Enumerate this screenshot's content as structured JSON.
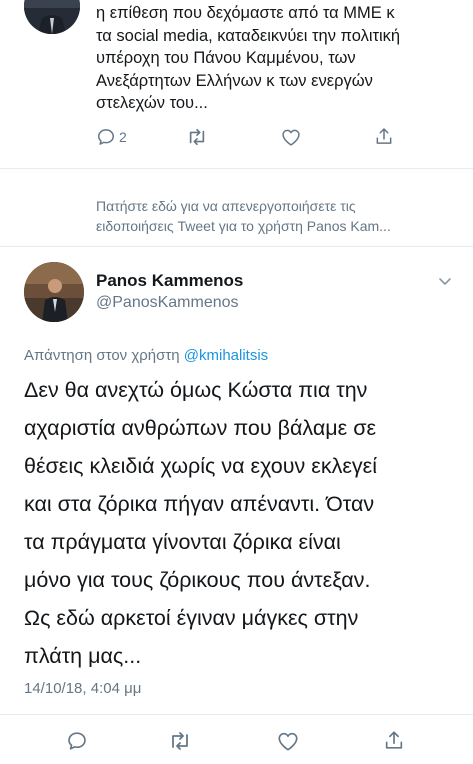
{
  "previous_tweet": {
    "text_lines": [
      "η επίθεση που δεχόμαστε από τα ΜΜΕ κ",
      "τα social media, καταδεικνύει την πολιτική",
      "υπέροχη του Πάνου Καμμένου, των",
      "Ανεξάρτητων Ελλήνων κ των ενεργών",
      "στελεχών του..."
    ],
    "reply_count": "2"
  },
  "notification": {
    "lines": [
      "Πατήστε εδώ για να απενεργοποιήσετε τις",
      "ειδοποιήσεις Tweet για το χρήστη Panos Kam..."
    ]
  },
  "tweet": {
    "display_name": "Panos Kammenos",
    "handle": "@PanosKammenos",
    "reply_prefix": "Απάντηση στον χρήστη ",
    "reply_mention": "@kmihalitsis",
    "text_lines": [
      "Δεν θα ανεχτώ όμως Κώστα πια την",
      "αχαριστία ανθρώπων που βάλαμε σε",
      "θέσεις κλειδιά χωρίς να εχουν εκλεγεί",
      "και στα ζόρικα πήγαν απέναντι. Όταν",
      "τα πράγματα γίνονται ζόρικα είναι",
      "μόνο για τους ζόρικους που άντεξαν.",
      "Ως εδώ αρκετοί έγιναν μάγκες στην",
      "πλάτη μας..."
    ],
    "timestamp": "14/10/18, 4:04 μμ"
  },
  "icons": {
    "reply": "reply-icon",
    "retweet": "retweet-icon",
    "like": "heart-icon",
    "share": "share-icon",
    "caret": "chevron-down-icon"
  },
  "colors": {
    "text": "#14171a",
    "secondary": "#657786",
    "link": "#1b95e0",
    "divider": "#e6ecf0"
  }
}
